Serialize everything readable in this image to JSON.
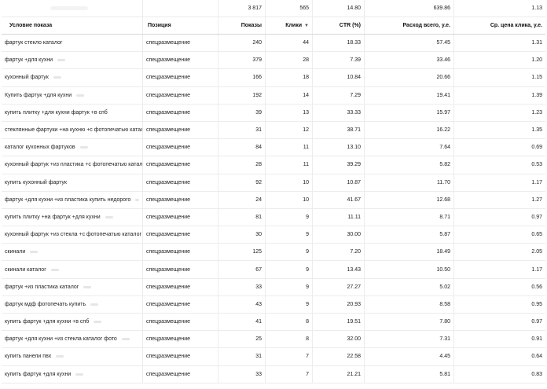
{
  "summary": {
    "shows": "3 817",
    "clicks": "565",
    "ctr": "14.80",
    "cost": "639.86",
    "avg_cpc": "1.13"
  },
  "headers": {
    "condition": "Условие показа",
    "position": "Позиция",
    "shows": "Показы",
    "clicks": "Клики",
    "clicks_sort_icon": "sort-down-icon",
    "ctr": "CTR (%)",
    "cost": "Расход всего, у.е.",
    "avg_cpc": "Ср. цена клика, у.е."
  },
  "rows": [
    {
      "condition": "фартук стекло каталог",
      "position": "спецразмещение",
      "shows": "240",
      "clicks": "44",
      "ctr": "18.33",
      "cost": "57.45",
      "cpc": "1.31"
    },
    {
      "condition": "фартук +для кухни",
      "position": "спецразмещение",
      "shows": "379",
      "clicks": "28",
      "ctr": "7.39",
      "cost": "33.46",
      "cpc": "1.20"
    },
    {
      "condition": "кухонный фартук",
      "position": "спецразмещение",
      "shows": "166",
      "clicks": "18",
      "ctr": "10.84",
      "cost": "20.66",
      "cpc": "1.15"
    },
    {
      "condition": "Купить фартук +для кухни",
      "position": "спецразмещение",
      "shows": "192",
      "clicks": "14",
      "ctr": "7.29",
      "cost": "19.41",
      "cpc": "1.39"
    },
    {
      "condition": "купить плитку +для кухни фартук +в спб",
      "position": "спецразмещение",
      "shows": "39",
      "clicks": "13",
      "ctr": "33.33",
      "cost": "15.97",
      "cpc": "1.23"
    },
    {
      "condition": "стеклянные фартуки +на кухню +с фотопечатью каталог",
      "position": "спецразмещение",
      "shows": "31",
      "clicks": "12",
      "ctr": "38.71",
      "cost": "16.22",
      "cpc": "1.35"
    },
    {
      "condition": "каталог кухонных фартуков",
      "position": "спецразмещение",
      "shows": "84",
      "clicks": "11",
      "ctr": "13.10",
      "cost": "7.64",
      "cpc": "0.69"
    },
    {
      "condition": "кухонный фартук +из пластика +с фотопечатью каталог",
      "position": "спецразмещение",
      "shows": "28",
      "clicks": "11",
      "ctr": "39.29",
      "cost": "5.82",
      "cpc": "0.53"
    },
    {
      "condition": "купить кухонный фартук",
      "position": "спецразмещение",
      "shows": "92",
      "clicks": "10",
      "ctr": "10.87",
      "cost": "11.70",
      "cpc": "1.17"
    },
    {
      "condition": "фартук +для кухни +из пластика купить недорого",
      "position": "спецразмещение",
      "shows": "24",
      "clicks": "10",
      "ctr": "41.67",
      "cost": "12.68",
      "cpc": "1.27"
    },
    {
      "condition": "купить плитку +на фартук +для кухни",
      "position": "спецразмещение",
      "shows": "81",
      "clicks": "9",
      "ctr": "11.11",
      "cost": "8.71",
      "cpc": "0.97"
    },
    {
      "condition": "кухонный фартук +из стекла +с фотопечатью каталог",
      "position": "спецразмещение",
      "shows": "30",
      "clicks": "9",
      "ctr": "30.00",
      "cost": "5.87",
      "cpc": "0.65"
    },
    {
      "condition": "скинали",
      "position": "спецразмещение",
      "shows": "125",
      "clicks": "9",
      "ctr": "7.20",
      "cost": "18.49",
      "cpc": "2.05"
    },
    {
      "condition": "скинали каталог",
      "position": "спецразмещение",
      "shows": "67",
      "clicks": "9",
      "ctr": "13.43",
      "cost": "10.50",
      "cpc": "1.17"
    },
    {
      "condition": "фартук +из пластика каталог",
      "position": "спецразмещение",
      "shows": "33",
      "clicks": "9",
      "ctr": "27.27",
      "cost": "5.02",
      "cpc": "0.56"
    },
    {
      "condition": "фартук мдф фотопечать купить",
      "position": "спецразмещение",
      "shows": "43",
      "clicks": "9",
      "ctr": "20.93",
      "cost": "8.58",
      "cpc": "0.95"
    },
    {
      "condition": "купить фартук +для кухни +в спб",
      "position": "спецразмещение",
      "shows": "41",
      "clicks": "8",
      "ctr": "19.51",
      "cost": "7.80",
      "cpc": "0.97"
    },
    {
      "condition": "фартук +для кухни +из стекла каталог фото",
      "position": "спецразмещение",
      "shows": "25",
      "clicks": "8",
      "ctr": "32.00",
      "cost": "7.31",
      "cpc": "0.91"
    },
    {
      "condition": "купить панели пвх",
      "position": "спецразмещение",
      "shows": "31",
      "clicks": "7",
      "ctr": "22.58",
      "cost": "4.45",
      "cpc": "0.64"
    },
    {
      "condition": "купить фартук +для кухни",
      "position": "спецразмещение",
      "shows": "33",
      "clicks": "7",
      "ctr": "21.21",
      "cost": "5.81",
      "cpc": "0.83"
    }
  ]
}
